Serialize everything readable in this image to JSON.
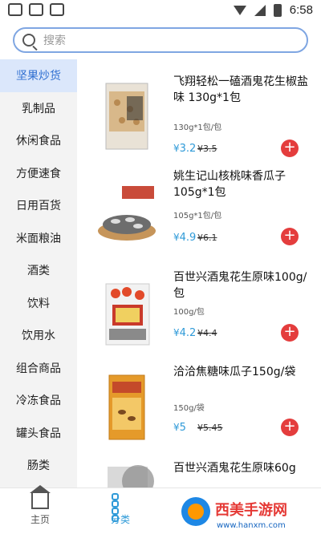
{
  "status_bar": {
    "time": "6:58"
  },
  "search": {
    "placeholder": "搜索"
  },
  "sidebar": {
    "items": [
      {
        "label": "坚果炒货",
        "active": true
      },
      {
        "label": "乳制品"
      },
      {
        "label": "休闲食品"
      },
      {
        "label": "方便速食"
      },
      {
        "label": "日用百货"
      },
      {
        "label": "米面粮油"
      },
      {
        "label": "酒类"
      },
      {
        "label": "饮料"
      },
      {
        "label": "饮用水"
      },
      {
        "label": "组合商品"
      },
      {
        "label": "冷冻食品"
      },
      {
        "label": "罐头食品"
      },
      {
        "label": "肠类"
      }
    ]
  },
  "products": [
    {
      "name": "飞翔轻松一磕酒鬼花生椒盐味 130g*1包",
      "spec": "130g*1包/包",
      "currency": "¥",
      "price": "3.2",
      "old_price": "¥3.5"
    },
    {
      "name": "姚生记山核桃味香瓜子105g*1包",
      "spec": "105g*1包/包",
      "currency": "¥",
      "price": "4.9",
      "old_price": "¥6.1"
    },
    {
      "name": "百世兴酒鬼花生原味100g/包",
      "spec": "100g/包",
      "currency": "¥",
      "price": "4.2",
      "old_price": "¥4.4"
    },
    {
      "name": "洽洽焦糖味瓜子150g/袋",
      "spec": "150g/袋",
      "currency": "¥",
      "price": "5",
      "old_price": "¥5.45"
    },
    {
      "name": "百世兴酒鬼花生原味60g",
      "spec": "",
      "currency": "",
      "price": "",
      "old_price": ""
    }
  ],
  "add_symbol": "+",
  "bottom_nav": {
    "home_label": "主页",
    "category_label": "分类"
  },
  "colors": {
    "accent": "#2f9ad8",
    "add_button": "#e43d3d",
    "active_side_bg": "#dbe7fb"
  },
  "watermark": {
    "text": "西美手游网",
    "url_text": "www.hanxm.com"
  }
}
